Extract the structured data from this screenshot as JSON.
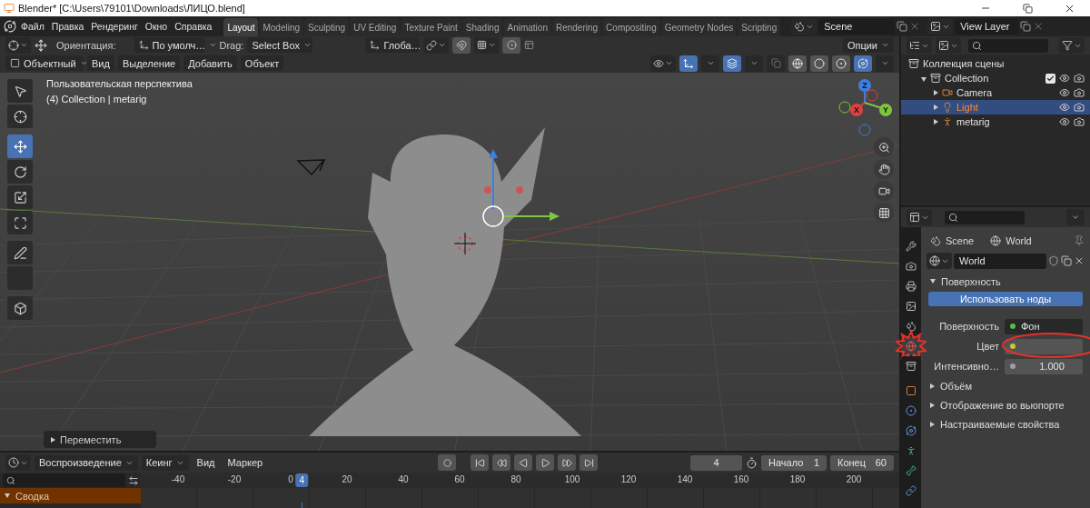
{
  "window": {
    "title": "Blender* [C:\\Users\\79101\\Downloads\\ЛИЦО.blend]"
  },
  "menu": [
    "Файл",
    "Правка",
    "Рендеринг",
    "Окно",
    "Справка"
  ],
  "workspaces": [
    {
      "label": "Layout",
      "selected": true
    },
    {
      "label": "Modeling",
      "selected": false
    },
    {
      "label": "Sculpting",
      "selected": false
    },
    {
      "label": "UV Editing",
      "selected": false
    },
    {
      "label": "Texture Paint",
      "selected": false
    },
    {
      "label": "Shading",
      "selected": false
    },
    {
      "label": "Animation",
      "selected": false
    },
    {
      "label": "Rendering",
      "selected": false
    },
    {
      "label": "Compositing",
      "selected": false
    },
    {
      "label": "Geometry Nodes",
      "selected": false
    },
    {
      "label": "Scripting",
      "selected": false
    }
  ],
  "scene": "Scene",
  "view_layer": "View Layer",
  "tool_settings": {
    "orientation_label": "Ориентация:",
    "orientation": "По умолч…",
    "drag_label": "Drag:",
    "drag": "Select Box",
    "transform_orientation": "Глоба…",
    "options": "Опции"
  },
  "viewport_header": {
    "mode": "Объектный",
    "menus": [
      "Вид",
      "Выделение",
      "Добавить",
      "Объект"
    ],
    "gizmos_on": true,
    "overlays_on": true,
    "shading": [
      {
        "kind": "wireframe",
        "selected": false
      },
      {
        "kind": "solid",
        "selected": false
      },
      {
        "kind": "material",
        "selected": false
      },
      {
        "kind": "rendered",
        "selected": true
      }
    ]
  },
  "toolbar": [
    {
      "kind": "select",
      "selected": false
    },
    {
      "kind": "cursor",
      "selected": false
    },
    {
      "kind": "move",
      "selected": true
    },
    {
      "kind": "rotate",
      "selected": false
    },
    {
      "kind": "scale",
      "selected": false
    },
    {
      "kind": "transform",
      "selected": false
    },
    {
      "kind": "annotate",
      "selected": false
    },
    {
      "kind": "measure",
      "selected": false
    },
    {
      "kind": "add_cube",
      "selected": false
    }
  ],
  "viewport": {
    "view_name": "Пользовательская перспектива",
    "context": "(4) Collection | metarig",
    "gizmo_axes": [
      "Z",
      "X",
      "Y"
    ],
    "last_operator": "Переместить"
  },
  "outliner": {
    "root": "Коллекция сцены",
    "collections": [
      {
        "label": "Collection",
        "expanded": true,
        "checked": true,
        "children": [
          {
            "label": "Camera",
            "kind": "camera",
            "selected": false
          },
          {
            "label": "Light",
            "kind": "light",
            "selected": true
          },
          {
            "label": "metarig",
            "kind": "armature",
            "selected": false
          }
        ]
      }
    ]
  },
  "properties": {
    "tabs": [
      {
        "kind": "tool",
        "selected": false,
        "highlighted": false
      },
      {
        "kind": "render",
        "selected": false,
        "highlighted": false
      },
      {
        "kind": "output",
        "selected": false,
        "highlighted": false
      },
      {
        "kind": "view_layer",
        "selected": false,
        "highlighted": false
      },
      {
        "kind": "scene",
        "selected": false,
        "highlighted": false
      },
      {
        "kind": "world",
        "selected": true,
        "highlighted": true
      },
      {
        "kind": "collection",
        "selected": false,
        "highlighted": false
      },
      {
        "kind": "object",
        "selected": false,
        "highlighted": false
      },
      {
        "kind": "physics",
        "selected": false,
        "highlighted": false
      },
      {
        "kind": "constraints",
        "selected": false,
        "highlighted": false
      },
      {
        "kind": "armature",
        "selected": false,
        "highlighted": false
      },
      {
        "kind": "bone",
        "selected": false,
        "highlighted": false
      },
      {
        "kind": "bone_constraints",
        "selected": false,
        "highlighted": false
      }
    ],
    "breadcrumb": [
      "Scene",
      "World"
    ],
    "world": "World",
    "panels": [
      {
        "title": "Поверхность",
        "expanded": true,
        "button": "Использовать ноды",
        "fields": [
          {
            "kind": "shader",
            "label": "Поверхность",
            "value": "Фон",
            "color": "#4fbf4f",
            "circled": false
          },
          {
            "kind": "color",
            "label": "Цвет",
            "color": "#c8c832",
            "circled": true
          },
          {
            "kind": "number",
            "label": "Интенсивно…",
            "value": "1.000",
            "color": "#a0a0a0",
            "circled": false
          }
        ]
      },
      {
        "title": "Объём",
        "expanded": false
      },
      {
        "title": "Отображение во вьюпорте",
        "expanded": false
      },
      {
        "title": "Настраиваемые свойства",
        "expanded": false
      }
    ]
  },
  "timeline": {
    "playback": "Воспроизведение",
    "keying": "Кеинг",
    "menus": [
      "Вид",
      "Маркер"
    ],
    "current_frame": "4",
    "start_label": "Начало",
    "start": "1",
    "end_label": "Конец",
    "end": "60",
    "playhead": "4",
    "ticks": [
      "-40",
      "-20",
      "0",
      "20",
      "40",
      "60",
      "80",
      "100",
      "120",
      "140",
      "160",
      "180",
      "200"
    ],
    "channels": [
      {
        "label": "Сводка",
        "expanded": true
      }
    ]
  }
}
